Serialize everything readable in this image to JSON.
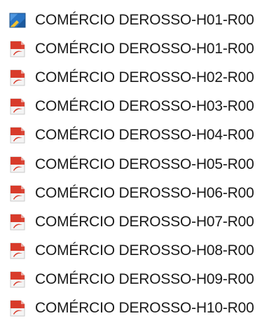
{
  "files": [
    {
      "name": "COMÉRCIO DEROSSO-H01-R00",
      "icon": "autocad-dwg-icon"
    },
    {
      "name": "COMÉRCIO DEROSSO-H01-R00",
      "icon": "pdf-icon"
    },
    {
      "name": "COMÉRCIO DEROSSO-H02-R00",
      "icon": "pdf-icon"
    },
    {
      "name": "COMÉRCIO DEROSSO-H03-R00",
      "icon": "pdf-icon"
    },
    {
      "name": "COMÉRCIO DEROSSO-H04-R00",
      "icon": "pdf-icon"
    },
    {
      "name": "COMÉRCIO DEROSSO-H05-R00",
      "icon": "pdf-icon"
    },
    {
      "name": "COMÉRCIO DEROSSO-H06-R00",
      "icon": "pdf-icon"
    },
    {
      "name": "COMÉRCIO DEROSSO-H07-R00",
      "icon": "pdf-icon"
    },
    {
      "name": "COMÉRCIO DEROSSO-H08-R00",
      "icon": "pdf-icon"
    },
    {
      "name": "COMÉRCIO DEROSSO-H09-R00",
      "icon": "pdf-icon"
    },
    {
      "name": "COMÉRCIO DEROSSO-H10-R00",
      "icon": "pdf-icon"
    }
  ],
  "colors": {
    "pdf_red": "#d83b2b",
    "pdf_page": "#f4f4f4",
    "dwg_blue": "#2a74c4",
    "dwg_yellow": "#f2c230",
    "text": "#1a1a1a"
  }
}
